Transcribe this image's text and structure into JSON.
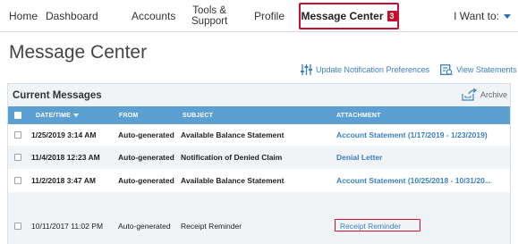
{
  "nav": {
    "home": "Home",
    "dashboard": "Dashboard",
    "accounts": "Accounts",
    "tools_line1": "Tools &",
    "tools_line2": "Support",
    "profile": "Profile",
    "message_center": "Message Center",
    "message_count": "3",
    "i_want_to": "I Want to:"
  },
  "page": {
    "title": "Message Center",
    "update_prefs": "Update Notification Preferences",
    "view_statements": "View Statements"
  },
  "messages": {
    "title": "Current Messages",
    "archive": "Archive",
    "columns": {
      "datetime": "DATE/TIME",
      "from": "FROM",
      "subject": "SUBJECT",
      "attachment": "ATTACHMENT"
    },
    "rows": [
      {
        "datetime": "1/25/2019 3:14 AM",
        "from": "Auto-generated",
        "subject": "Available Balance Statement",
        "attachment": "Account Statement (1/17/2019 - 1/23/2019)"
      },
      {
        "datetime": "11/4/2018 12:23 AM",
        "from": "Auto-generated",
        "subject": "Notification of Denied Claim",
        "attachment": "Denial Letter"
      },
      {
        "datetime": "11/2/2018 3:47 AM",
        "from": "Auto-generated",
        "subject": "Available Balance Statement",
        "attachment": "Account Statement (10/25/2018 - 10/31/20..."
      },
      {
        "datetime": "10/11/2017 11:02 PM",
        "from": "Auto-generated",
        "subject": "Receipt Reminder",
        "attachment": "Receipt Reminder"
      }
    ]
  },
  "colors": {
    "accent": "#3a80c1",
    "header_blue": "#5c9fd2",
    "highlight_red": "#c8102e"
  }
}
